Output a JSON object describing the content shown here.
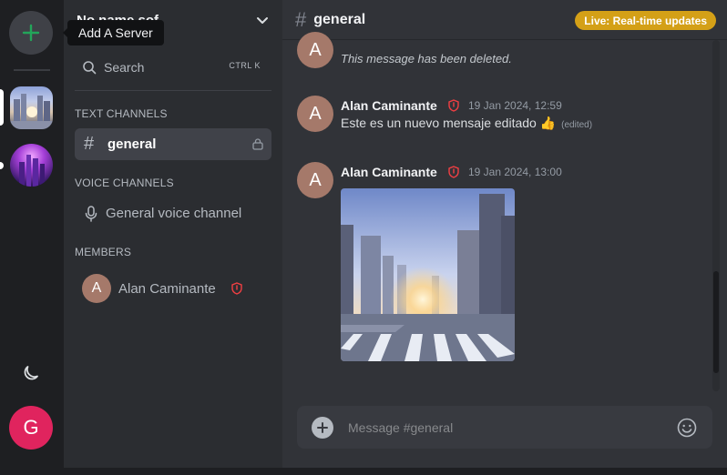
{
  "rail": {
    "add_server_tooltip": "Add A Server",
    "user_avatar_letter": "G"
  },
  "sidebar": {
    "server_name": "No name sof",
    "search_label": "Search",
    "search_shortcut": "CTRL K",
    "text_channels_heading": "TEXT CHANNELS",
    "voice_channels_heading": "VOICE CHANNELS",
    "members_heading": "MEMBERS",
    "text_channels": [
      {
        "label": "general"
      }
    ],
    "voice_channels": [
      {
        "label": "General voice channel"
      }
    ],
    "members": [
      {
        "name": "Alan Caminante",
        "avatar_letter": "A"
      }
    ]
  },
  "header": {
    "channel_name": "general",
    "live_badge": "Live: Real-time updates"
  },
  "messages": [
    {
      "avatar_letter": "A",
      "text": "This message has been deleted.",
      "deleted": true
    },
    {
      "avatar_letter": "A",
      "author": "Alan Caminante",
      "time": "19 Jan 2024, 12:59",
      "text": "Este es un nuevo mensaje editado 👍",
      "edited_label": "(edited)"
    },
    {
      "avatar_letter": "A",
      "author": "Alan Caminante",
      "time": "19 Jan 2024, 13:00",
      "attachment": "city-street-image"
    }
  ],
  "composer": {
    "placeholder": "Message #general"
  },
  "colors": {
    "accent_live": "#d4a017",
    "user_avatar": "#e0245e",
    "member_avatar": "#a5796a",
    "shield": "#f23f43",
    "add_plus": "#23a55a"
  }
}
